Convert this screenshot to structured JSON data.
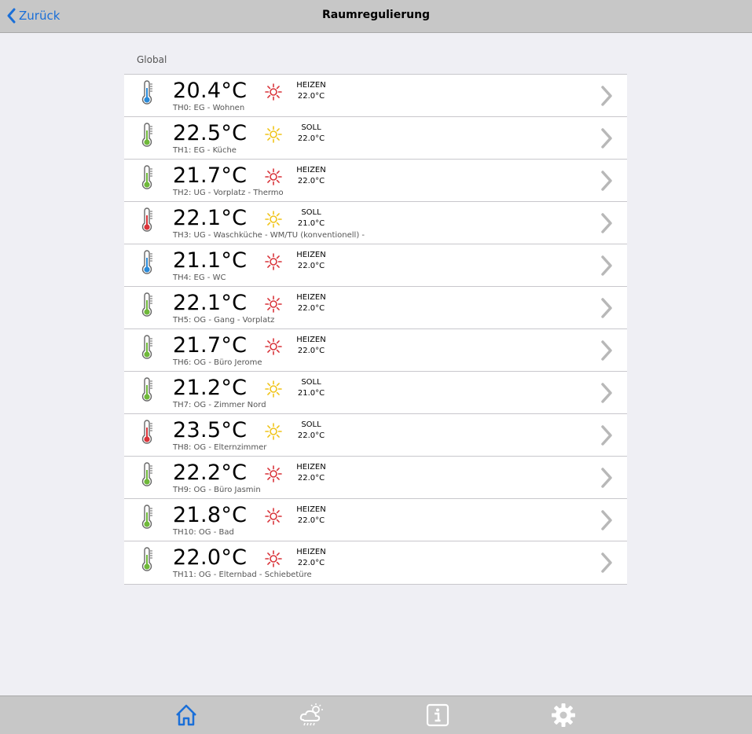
{
  "header": {
    "back_label": "Zurück",
    "title": "Raumregulierung"
  },
  "section": {
    "label": "Global"
  },
  "colors": {
    "accent": "#1a6fd8",
    "heizen": "#d9343a",
    "soll": "#f0c419",
    "thermo_blue": "#2a8ad8",
    "thermo_green": "#6fb83a",
    "thermo_red": "#d9343a",
    "chevron": "#b8b8b8"
  },
  "rows": [
    {
      "temp": "20.4°C",
      "name": "TH0: EG - Wohnen",
      "mode": "HEIZEN",
      "setpoint": "22.0°C",
      "thermo": "blue"
    },
    {
      "temp": "22.5°C",
      "name": "TH1: EG - Küche",
      "mode": "SOLL",
      "setpoint": "22.0°C",
      "thermo": "green"
    },
    {
      "temp": "21.7°C",
      "name": "TH2: UG - Vorplatz - Thermo",
      "mode": "HEIZEN",
      "setpoint": "22.0°C",
      "thermo": "green"
    },
    {
      "temp": "22.1°C",
      "name": "TH3: UG - Waschküche - WM/TU (konventionell) -",
      "mode": "SOLL",
      "setpoint": "21.0°C",
      "thermo": "red"
    },
    {
      "temp": "21.1°C",
      "name": "TH4: EG - WC",
      "mode": "HEIZEN",
      "setpoint": "22.0°C",
      "thermo": "blue"
    },
    {
      "temp": "22.1°C",
      "name": "TH5: OG - Gang - Vorplatz",
      "mode": "HEIZEN",
      "setpoint": "22.0°C",
      "thermo": "green"
    },
    {
      "temp": "21.7°C",
      "name": "TH6: OG - Büro Jerome",
      "mode": "HEIZEN",
      "setpoint": "22.0°C",
      "thermo": "green"
    },
    {
      "temp": "21.2°C",
      "name": "TH7: OG - Zimmer Nord",
      "mode": "SOLL",
      "setpoint": "21.0°C",
      "thermo": "green"
    },
    {
      "temp": "23.5°C",
      "name": "TH8: OG - Elternzimmer",
      "mode": "SOLL",
      "setpoint": "22.0°C",
      "thermo": "red"
    },
    {
      "temp": "22.2°C",
      "name": "TH9: OG - Büro Jasmin",
      "mode": "HEIZEN",
      "setpoint": "22.0°C",
      "thermo": "green"
    },
    {
      "temp": "21.8°C",
      "name": "TH10: OG - Bad",
      "mode": "HEIZEN",
      "setpoint": "22.0°C",
      "thermo": "green"
    },
    {
      "temp": "22.0°C",
      "name": "TH11: OG - Elternbad - Schiebetüre",
      "mode": "HEIZEN",
      "setpoint": "22.0°C",
      "thermo": "green"
    }
  ],
  "tabs": [
    {
      "icon": "home-icon",
      "active": true
    },
    {
      "icon": "weather-icon",
      "active": false
    },
    {
      "icon": "info-icon",
      "active": false
    },
    {
      "icon": "gear-icon",
      "active": false
    }
  ]
}
